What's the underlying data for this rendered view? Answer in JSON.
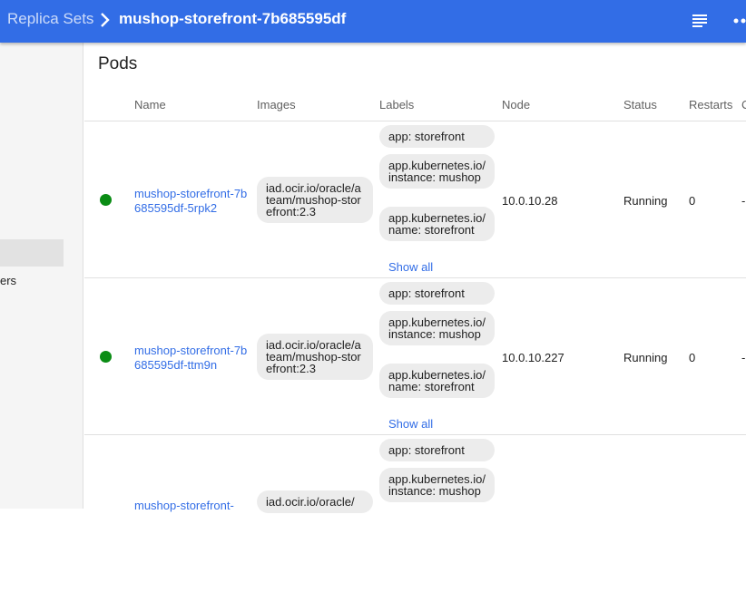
{
  "breadcrumb": {
    "parent": "Replica Sets",
    "current": "mushop-storefront-7b685595df"
  },
  "sidebar": {
    "partial_item": "ers"
  },
  "card": {
    "title": "Pods",
    "columns": [
      "Name",
      "Images",
      "Labels",
      "Node",
      "Status",
      "Restarts",
      "C"
    ]
  },
  "pods": [
    {
      "name": "mushop-storefront-7b685595df-5rpk2",
      "image": "iad.ocir.io/oracle/ateam/mushop-storefront:2.3",
      "labels": [
        "app: storefront",
        "app.kubernetes.io/instance: mushop",
        "app.kubernetes.io/name: storefront"
      ],
      "show_all": "Show all",
      "node": "10.0.10.28",
      "status": "Running",
      "restarts": "0",
      "extra": "-"
    },
    {
      "name": "mushop-storefront-7b685595df-ttm9n",
      "image": "iad.ocir.io/oracle/ateam/mushop-storefront:2.3",
      "labels": [
        "app: storefront",
        "app.kubernetes.io/instance: mushop",
        "app.kubernetes.io/name: storefront"
      ],
      "show_all": "Show all",
      "node": "10.0.10.227",
      "status": "Running",
      "restarts": "0",
      "extra": "-"
    },
    {
      "name": "mushop-storefront-",
      "image": "iad.ocir.io/oracle/",
      "labels": [
        "app: storefront",
        "app.kubernetes.io/instance: mushop"
      ]
    }
  ],
  "colors": {
    "brand": "#326de6",
    "running": "#0a8c14"
  },
  "icons": {
    "menu": "list-icon",
    "more": "more-icon",
    "separator": "chevron-right-icon"
  }
}
